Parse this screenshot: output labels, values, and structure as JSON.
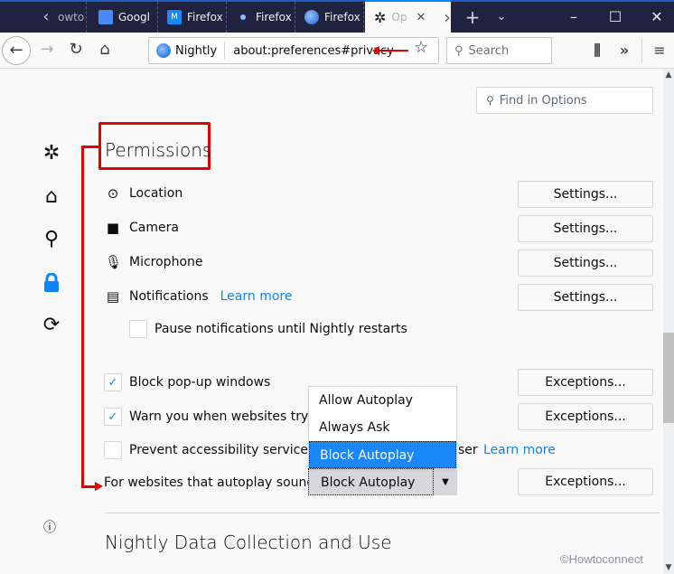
{
  "tabs": [
    {
      "label": "owto",
      "icon": "howto-favicon"
    },
    {
      "label": "Googl",
      "icon": "google-translate-icon"
    },
    {
      "label": "Firefox",
      "icon": "m-favicon"
    },
    {
      "label": "Firefox",
      "icon": "dot-favicon"
    },
    {
      "label": "Firefox",
      "icon": "firefox-icon"
    },
    {
      "label": "Op",
      "icon": "gear-icon",
      "active": true
    }
  ],
  "navbar": {
    "identity_label": "Nightly",
    "url": "about:preferences#privacy",
    "search_placeholder": "Search"
  },
  "find": {
    "placeholder": "Find in Options"
  },
  "permissions": {
    "title": "Permissions",
    "rows": [
      {
        "label": "Location",
        "icon": "location-icon",
        "button": "Settings..."
      },
      {
        "label": "Camera",
        "icon": "camera-icon",
        "button": "Settings..."
      },
      {
        "label": "Microphone",
        "icon": "microphone-icon",
        "button": "Settings..."
      },
      {
        "label": "Notifications",
        "icon": "notifications-icon",
        "link": "Learn more",
        "button": "Settings..."
      }
    ],
    "pause_notifications": {
      "label": "Pause notifications until Nightly restarts",
      "checked": false
    },
    "block_popups": {
      "label": "Block pop-up windows",
      "checked": true,
      "button": "Exceptions..."
    },
    "warn_addons": {
      "label": "Warn you when websites try to",
      "checked": true,
      "button": "Exceptions..."
    },
    "prevent_a11y": {
      "label_left": "Prevent accessibility services fi",
      "label_right": "ser",
      "checked": false,
      "link": "Learn more"
    },
    "autoplay": {
      "label": "For websites that autoplay sound",
      "selected": "Block Autoplay",
      "options": [
        "Allow Autoplay",
        "Always Ask",
        "Block Autoplay"
      ],
      "button": "Exceptions..."
    }
  },
  "data_collection": {
    "title": "Nightly Data Collection and Use"
  },
  "watermark": "©Howtoconnect",
  "colors": {
    "accent": "#0a84ff",
    "annotation": "#e30000",
    "tabbar": "#202340"
  }
}
